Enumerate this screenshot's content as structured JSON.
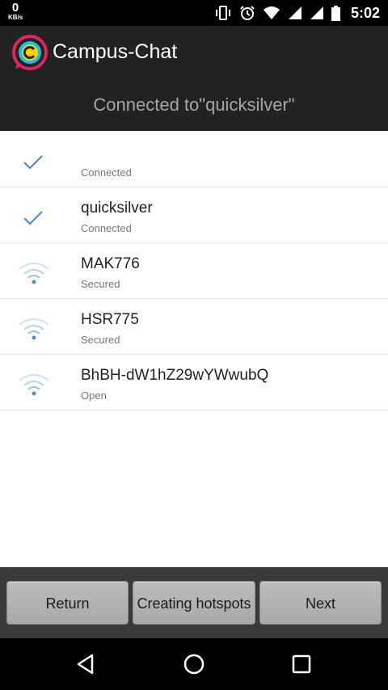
{
  "status_bar": {
    "data_rate_value": "0",
    "data_rate_unit": "KB/s",
    "time": "5:02",
    "icons": [
      "vibrate-icon",
      "alarm-icon",
      "wifi-icon",
      "signal-icon",
      "signal-icon",
      "battery-icon"
    ]
  },
  "app_bar": {
    "title": "Campus-Chat",
    "logo_colors": [
      "#e0245e",
      "#ffd200",
      "#16c0e8"
    ]
  },
  "banner": {
    "text": "Connected to\"quicksilver\""
  },
  "wifi_list": [
    {
      "ssid": "",
      "state": "Connected",
      "icon": "check-icon"
    },
    {
      "ssid": "quicksilver",
      "state": "Connected",
      "icon": "check-icon"
    },
    {
      "ssid": "MAK776",
      "state": "Secured",
      "icon": "wifi-icon"
    },
    {
      "ssid": "HSR775",
      "state": "Secured",
      "icon": "wifi-icon"
    },
    {
      "ssid": "BhBH-dW1hZ29wYWwubQ",
      "state": "Open",
      "icon": "wifi-icon"
    }
  ],
  "actions": {
    "return_label": "Return",
    "hotspot_label": "Creating hotspots",
    "next_label": "Next"
  },
  "nav_bar": {
    "icons": [
      "back-icon",
      "home-icon",
      "recent-apps-icon"
    ]
  },
  "colors": {
    "accent": "#4a90c8",
    "app_bar": "#222222",
    "banner_text": "#a6a6a6"
  }
}
